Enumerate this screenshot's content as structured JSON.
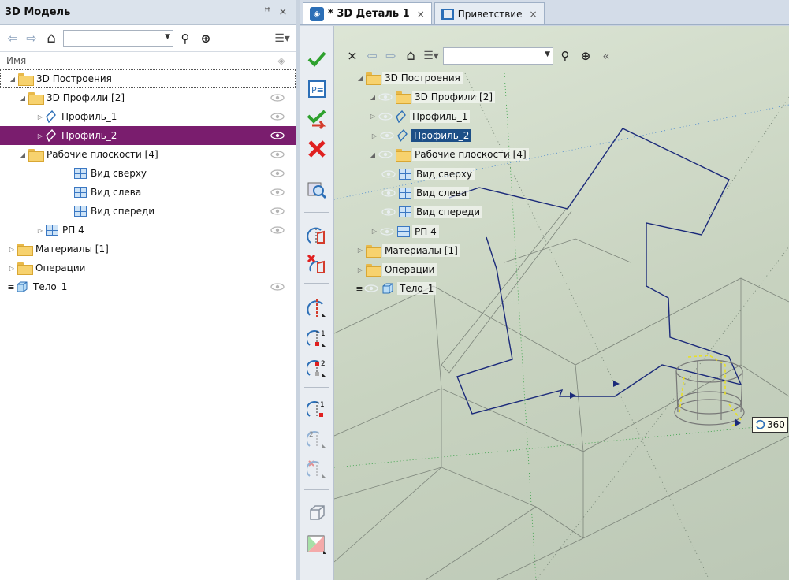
{
  "left_panel": {
    "title": "3D Модель",
    "pin_icon": "pin-icon",
    "close_label": "×",
    "column_header": "Имя",
    "tree": [
      {
        "label": "3D Построения",
        "icon": "folder",
        "level": 0,
        "expanded": true
      },
      {
        "label": "3D Профили [2]",
        "icon": "folder",
        "level": 1,
        "expanded": true
      },
      {
        "label": "Профиль_1",
        "icon": "profile",
        "level": 2,
        "expanded": false
      },
      {
        "label": "Профиль_2",
        "icon": "profile",
        "level": 2,
        "expanded": false,
        "selected": true
      },
      {
        "label": "Рабочие плоскости [4]",
        "icon": "folder",
        "level": 1,
        "expanded": true
      },
      {
        "label": "Вид сверху",
        "icon": "plane",
        "level": 3
      },
      {
        "label": "Вид слева",
        "icon": "plane",
        "level": 3
      },
      {
        "label": "Вид спереди",
        "icon": "plane",
        "level": 3
      },
      {
        "label": "РП 4",
        "icon": "plane",
        "level": 2,
        "expanded": false
      },
      {
        "label": "Материалы [1]",
        "icon": "folder",
        "level": 0,
        "expanded": false
      },
      {
        "label": "Операции",
        "icon": "folder",
        "level": 0,
        "expanded": false
      },
      {
        "label": "Тело_1",
        "icon": "body",
        "level": 0
      }
    ]
  },
  "tabs": [
    {
      "label": "* 3D Деталь 1",
      "close": "×",
      "active": true
    },
    {
      "label": "Приветствие",
      "close": "×",
      "active": false
    }
  ],
  "floating_tree": [
    {
      "label": "3D Построения",
      "icon": "folder"
    },
    {
      "label": "3D Профили [2]",
      "icon": "folder"
    },
    {
      "label": "Профиль_1",
      "icon": "profile"
    },
    {
      "label": "Профиль_2",
      "icon": "profile",
      "highlighted": true
    },
    {
      "label": "Рабочие плоскости [4]",
      "icon": "folder"
    },
    {
      "label": "Вид сверху",
      "icon": "plane"
    },
    {
      "label": "Вид слева",
      "icon": "plane"
    },
    {
      "label": "Вид спереди",
      "icon": "plane"
    },
    {
      "label": "РП 4",
      "icon": "plane"
    },
    {
      "label": "Материалы [1]",
      "icon": "folder"
    },
    {
      "label": "Операции",
      "icon": "folder"
    },
    {
      "label": "Тело_1",
      "icon": "body"
    }
  ],
  "floating_toolbar": {
    "close_label": "×"
  },
  "angle_value": "360",
  "colors": {
    "selection": "#7a1d6e",
    "highlight": "#1d4f87",
    "profile_line": "#1b2a7a",
    "accent": "#2c6fb7"
  }
}
